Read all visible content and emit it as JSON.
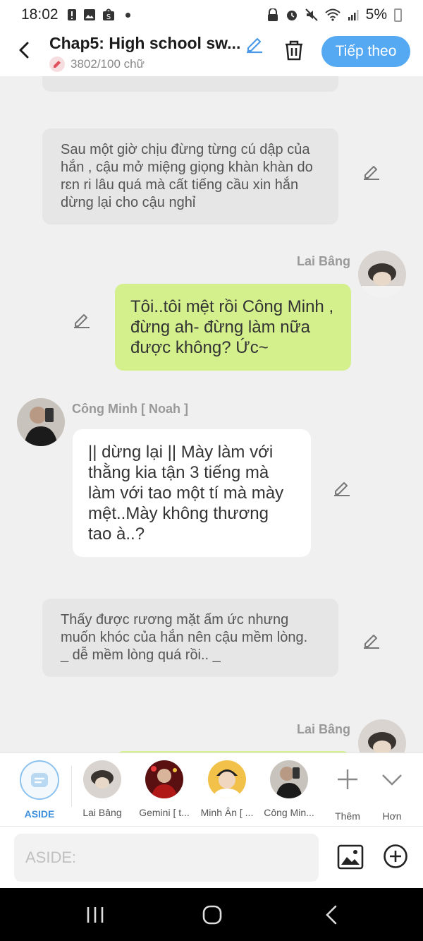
{
  "status_bar": {
    "time": "18:02",
    "battery": "5%"
  },
  "header": {
    "title": "Chap5: High school sw...",
    "word_count": "3802/100 chữ",
    "follow_label": "Tiếp theo"
  },
  "chat": {
    "narration_1": "Sau một giờ chịu đừng từng cú dập của hắn , cậu mở miệng giọng khàn khàn do rɛn ri lâu quá mà cất tiếng cầu xin hắn dừng lại cho cậu nghỉ",
    "speaker_1": "Lai Bâng",
    "message_1": "Tôi..tôi mệt rồi Công Minh , đừng ah- đừng làm nữa được không? Ức~",
    "speaker_2": "Công Minh [ Noah ]",
    "message_2": "|| dừng lại || Mày làm với thằng kia tận 3 tiếng mà làm với tao một tí mà mày mệt..Mày không thương tao à..?",
    "narration_2_line1": "Thấy được rương mặt ấm ức nhưng muốn khóc của hắn nên cậu mềm lòng.",
    "narration_2_line2": "_ dễ mềm lòng quá rồi.. _",
    "speaker_3": "Lai Bâng"
  },
  "characters": {
    "aside_label": "ASIDE",
    "items": [
      {
        "label": "Lai Bâng"
      },
      {
        "label": "Gemini [ t..."
      },
      {
        "label": "Minh Ân [ ..."
      },
      {
        "label": "Công Min..."
      }
    ],
    "more_label": "Thêm",
    "expand_label": "Hơn"
  },
  "input": {
    "placeholder": "ASIDE:"
  },
  "colors": {
    "accent": "#55a9f2",
    "green_bubble": "#d3f08c",
    "narration_bg": "#e6e6e6"
  }
}
